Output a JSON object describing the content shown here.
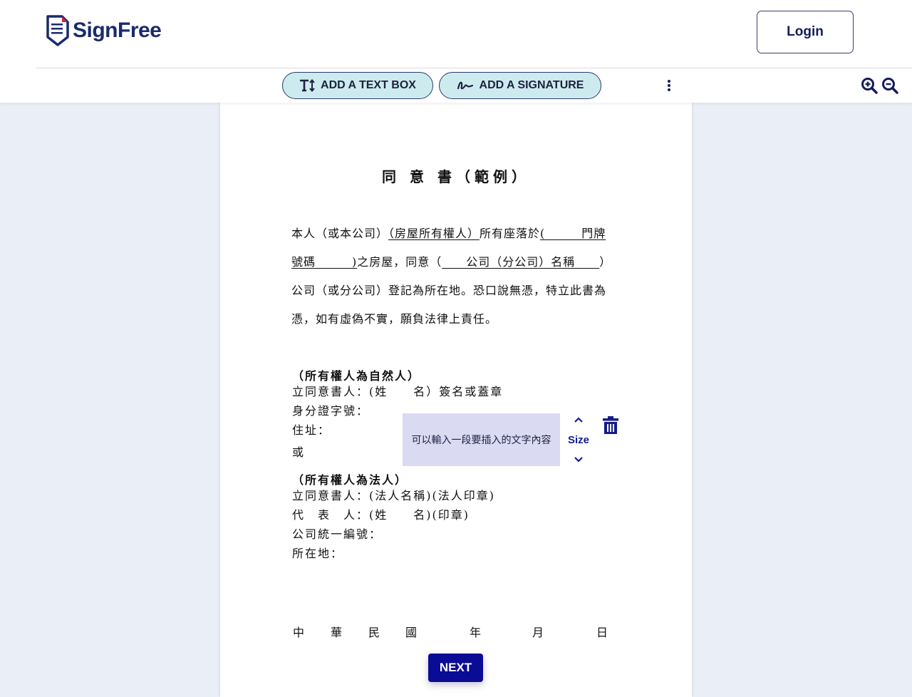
{
  "header": {
    "logo_text": "SignFree",
    "login_label": "Login"
  },
  "toolbar": {
    "add_text_box_label": "ADD A TEXT BOX",
    "add_signature_label": "ADD A SIGNATURE",
    "icons": [
      "text-size-icon",
      "signature-icon",
      "more-vertical-icon",
      "zoom-in-icon",
      "zoom-out-icon"
    ]
  },
  "document": {
    "title": "同 意 書（範例）",
    "paragraph": {
      "line1_a": "本人（或本公司）",
      "line1_b": "（房屋所有權人）",
      "line1_c": "所有座落於",
      "line1_d": "(　　　門牌",
      "line2_a": "號碼　　　)",
      "line2_b": "之房屋，同意（",
      "line2_c": "　　公司（分公司）名稱　　",
      "line2_d": "）",
      "line3": "公司（或分公司）登記為所在地。恐口說無憑，特立此書為",
      "line4": "憑，如有虛偽不實，願負法律上責任。"
    },
    "natural_person": {
      "heading": "（所有權人為自然人）",
      "signer": "立同意書人：(姓　　名）簽名或蓋章",
      "id_number": "身分證字號：",
      "address": "住址：",
      "or": "或"
    },
    "legal_person": {
      "heading": "（所有權人為法人）",
      "signer": "立同意書人：(法人名稱)(法人印章)",
      "representative": "代　表　人：(姓　　名)(印章)",
      "company_id": "公司統一編號：",
      "location": "所在地："
    },
    "date_row": [
      "中",
      "華",
      "民",
      "國",
      "年",
      "月",
      "日"
    ]
  },
  "text_box": {
    "content": "可以輸入一段要插入的文字內容",
    "size_label": "Size"
  },
  "next_label": "NEXT",
  "colors": {
    "brand_navy": "#1b2a6b",
    "pill_bg": "#cdebee",
    "textbox_bg": "#dadaf3",
    "next_bg": "#0b0c96",
    "canvas_bg": "#eaeef7"
  }
}
